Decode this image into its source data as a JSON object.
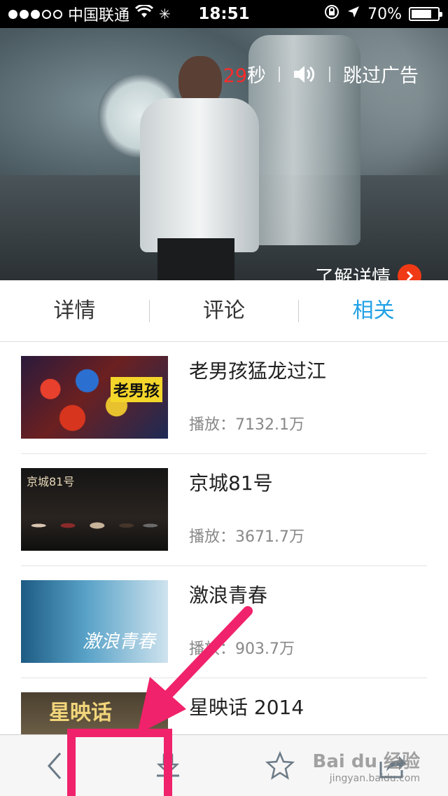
{
  "status_bar": {
    "carrier": "中国联通",
    "time": "18:51",
    "battery": "70%",
    "signal_filled": 3,
    "signal_total": 5
  },
  "ad": {
    "countdown_number": "29",
    "countdown_unit": "秒",
    "skip": "跳过广告",
    "learn_more": "了解详情"
  },
  "tabs": [
    {
      "label": "详情",
      "active": false
    },
    {
      "label": "评论",
      "active": false
    },
    {
      "label": "相关",
      "active": true
    }
  ],
  "related": [
    {
      "title": "老男孩猛龙过江",
      "plays": "播放：7132.1万",
      "thumb_text": "老男孩"
    },
    {
      "title": "京城81号",
      "plays": "播放：3671.7万",
      "thumb_text": "京城81号"
    },
    {
      "title": "激浪青春",
      "plays": "播放：903.7万",
      "thumb_text": "激浪青春"
    },
    {
      "title": "星映话 2014",
      "plays": "",
      "thumb_text": "星映话"
    }
  ],
  "toolbar": {
    "icons": [
      "back-icon",
      "download-icon",
      "star-icon",
      "share-icon"
    ]
  },
  "watermark": {
    "brand": "Bai du 经验",
    "url": "jingyan.baidu.com"
  },
  "colors": {
    "accent": "#22a1e6",
    "annotation": "#f0226b",
    "countdown": "#ff2a2a"
  }
}
